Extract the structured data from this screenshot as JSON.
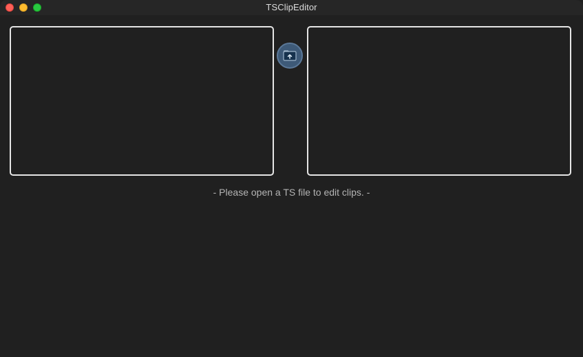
{
  "window": {
    "title": "TSClipEditor"
  },
  "toolbar": {
    "open_button_icon": "folder-open-icon"
  },
  "status": {
    "message": "- Please open a TS file to edit clips. -"
  },
  "colors": {
    "background": "#202020",
    "pane_border": "#e6e6e6",
    "button_fill": "#3e5a78",
    "status_text": "#b4b4b4"
  }
}
